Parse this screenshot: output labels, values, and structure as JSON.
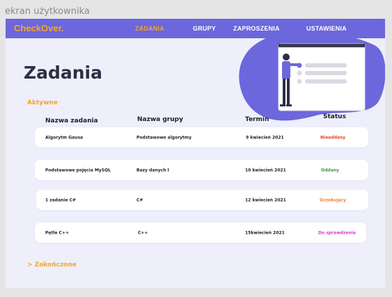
{
  "frame_label": "ekran użytkownika",
  "header": {
    "logo": "CheckOver.",
    "nav": [
      {
        "label": "ZADANIA",
        "active": true
      },
      {
        "label": "GRUPY",
        "active": false
      },
      {
        "label": "ZAPROSZENIA",
        "active": false
      },
      {
        "label": "USTAWIENIA",
        "active": false
      }
    ]
  },
  "page_title": "Zadania",
  "sections": {
    "active": "Aktywne",
    "finished": "> Zakończone"
  },
  "table": {
    "columns": [
      "Nazwa zadania",
      "Nazwa grupy",
      "Termin",
      "Status"
    ],
    "rows": [
      {
        "task": "Algorytm Gausa",
        "group": "Podstawowe algorytmy",
        "deadline": "9 kwiecień 2021",
        "status": "Nieoddany",
        "status_color": "#e8402a"
      },
      {
        "task": "Podstawowe pojęcia MySQL",
        "group": "Bazy danych I",
        "deadline": "10 kwiecień 2021",
        "status": "Oddany",
        "status_color": "#2ea043"
      },
      {
        "task": "1 zadanie C#",
        "group": "C#",
        "deadline": "12 kwiecień 2021",
        "status": "Oczekujący",
        "status_color": "#f07d2a"
      },
      {
        "task": "Pętle C++",
        "group": "C++",
        "deadline": "15kwiecień 2021",
        "status": "Do sprawdzenia",
        "status_color": "#d63ad6"
      }
    ]
  },
  "colors": {
    "topbar": "#6c67dc",
    "accent": "#f5a623",
    "background": "#eeeffb"
  }
}
